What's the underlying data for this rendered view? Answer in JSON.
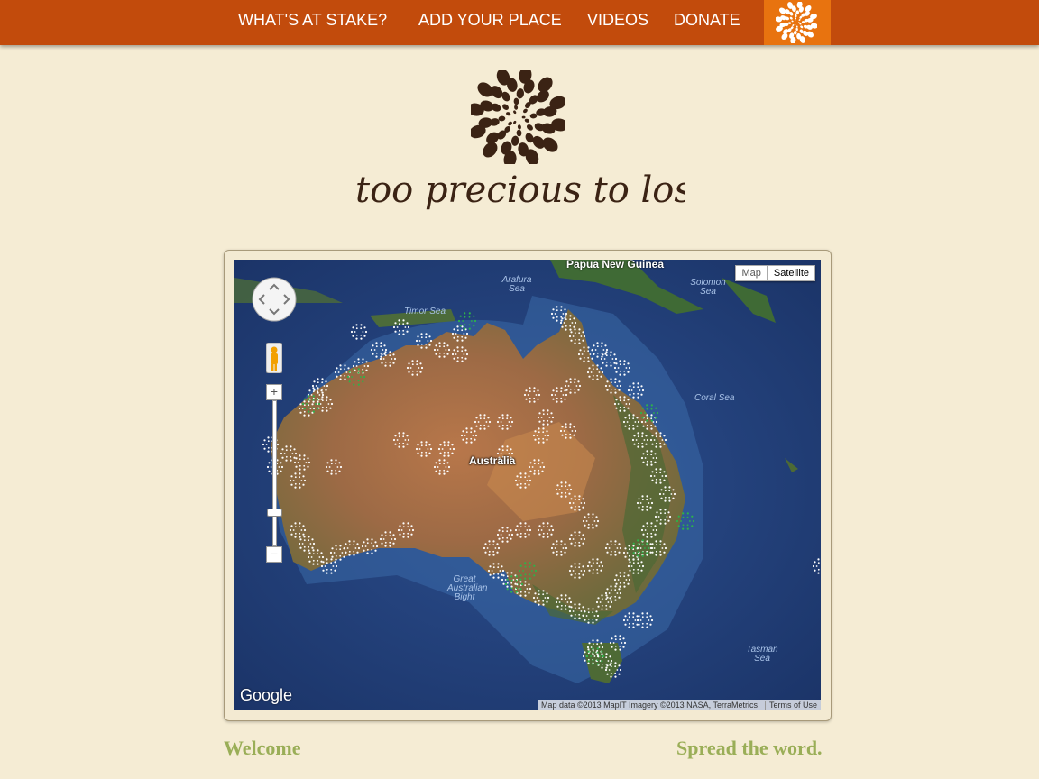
{
  "nav": {
    "items": [
      {
        "label": "WHAT'S AT STAKE?",
        "icon": ""
      },
      {
        "label": "ADD YOUR PLACE",
        "icon": ""
      },
      {
        "label": "VIDEOS",
        "icon": ""
      },
      {
        "label": "DONATE",
        "icon": ""
      }
    ],
    "logo_icon": "spiral-dots-icon"
  },
  "brand": {
    "tagline": "too precious to lose"
  },
  "map": {
    "type_buttons": [
      "Map",
      "Satellite"
    ],
    "active_type": "Satellite",
    "labels": {
      "png": "Papua New Guinea",
      "arafura": "Arafura Sea",
      "solomon": "Solomon Sea",
      "timor": "Timor Sea",
      "coral": "Coral Sea",
      "australia": "Australia",
      "gab": "Great Australian Bight",
      "tasman": "Tasman Sea"
    },
    "google": "Google",
    "attribution": "Map data ©2013 MapIT Imagery ©2013 NASA, TerraMetrics",
    "terms": "Terms of Use",
    "zoom_in": "+",
    "zoom_out": "−",
    "marker_colors": {
      "white": "#ffffff",
      "green": "#2db34a"
    }
  },
  "footer": {
    "welcome": "Welcome",
    "spread": "Spread the word."
  },
  "colors": {
    "nav_bg": "#c24b0c",
    "nav_logo_bg": "#e8730f",
    "page_bg": "#f5ecd4",
    "accent_green": "#9aae57",
    "brand_brown": "#3b2314"
  }
}
